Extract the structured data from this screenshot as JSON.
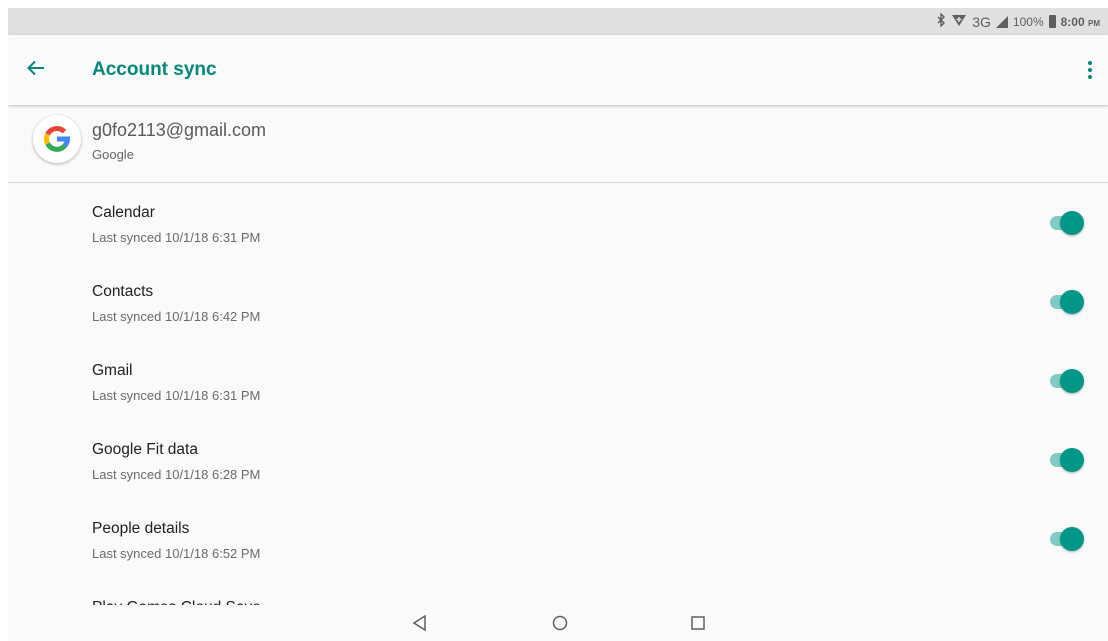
{
  "status_bar": {
    "network": "3G",
    "battery": "100%",
    "time": "8:00",
    "ampm": "PM",
    "icons": [
      "bluetooth-icon",
      "data-saver-icon",
      "signal-icon",
      "battery-icon"
    ]
  },
  "app_bar": {
    "title": "Account sync",
    "back_icon": "arrow-left-icon",
    "menu_icon": "more-vertical-icon"
  },
  "account": {
    "email": "g0fo2113@gmail.com",
    "type": "Google",
    "logo": "google-logo"
  },
  "sync_items": [
    {
      "name": "Calendar",
      "status": "Last synced 10/1/18 6:31 PM",
      "enabled": true
    },
    {
      "name": "Contacts",
      "status": "Last synced 10/1/18 6:42 PM",
      "enabled": true
    },
    {
      "name": "Gmail",
      "status": "Last synced 10/1/18 6:31 PM",
      "enabled": true
    },
    {
      "name": "Google Fit data",
      "status": "Last synced 10/1/18 6:28 PM",
      "enabled": true
    },
    {
      "name": "People details",
      "status": "Last synced 10/1/18 6:52 PM",
      "enabled": true
    },
    {
      "name": "Play Games Cloud Save",
      "status": "",
      "enabled": true
    }
  ],
  "nav_bar": {
    "buttons": [
      "back-triangle-icon",
      "home-circle-icon",
      "recents-square-icon"
    ]
  },
  "colors": {
    "accent": "#00897b",
    "toggle_thumb": "#009688",
    "toggle_track": "#80cbc4",
    "status_bar_bg": "#e0e0e0",
    "background": "#fafafa"
  }
}
